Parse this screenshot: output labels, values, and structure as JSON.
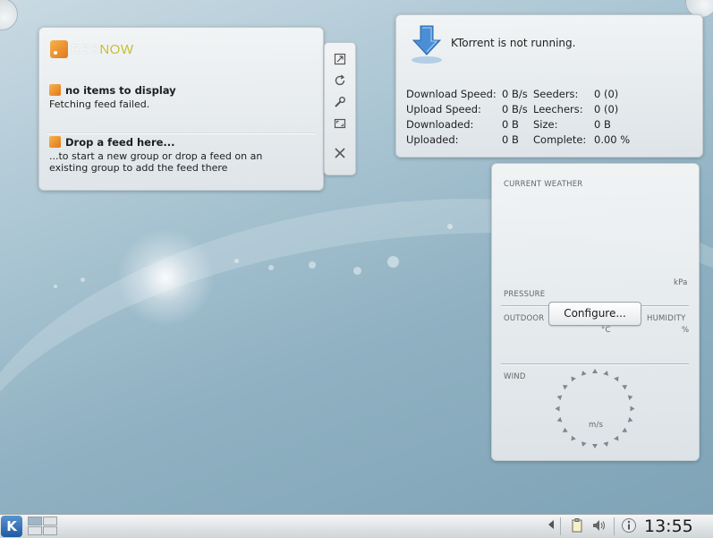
{
  "rss": {
    "logo_part1": "RSS",
    "logo_part2": "NOW",
    "item1_title": "no items to display",
    "item1_body": "Fetching feed failed.",
    "item2_title": "Drop a feed here...",
    "item2_body_line1": "...to start a new group or drop a feed on an",
    "item2_body_line2": "existing group to add the feed there"
  },
  "ktorrent": {
    "status": "KTorrent is not running.",
    "stats": [
      {
        "label": "Download Speed:",
        "value": "0 B/s",
        "label2": "Seeders:",
        "value2": "0 (0)"
      },
      {
        "label": "Upload Speed:",
        "value": "0 B/s",
        "label2": "Leechers:",
        "value2": "0 (0)"
      },
      {
        "label": "Downloaded:",
        "value": "0 B",
        "label2": "Size:",
        "value2": "0 B"
      },
      {
        "label": "Uploaded:",
        "value": "0 B",
        "label2": "Complete:",
        "value2": "0.00 %"
      }
    ]
  },
  "weather": {
    "current_weather": "CURRENT WEATHER",
    "pressure_unit": "kPa",
    "pressure": "PRESSURE",
    "outdoor": "OUTDOOR",
    "humidity": "HUMIDITY",
    "celsius": "°C",
    "percent": "%",
    "configure_label": "Configure...",
    "wind": "WIND",
    "wind_unit": "m/s"
  },
  "panel": {
    "clock": "13:55"
  },
  "icons": {
    "maximize": "maximize-icon",
    "refresh": "refresh-icon",
    "configure": "wrench-icon",
    "resize": "resize-icon",
    "close": "close-icon"
  }
}
